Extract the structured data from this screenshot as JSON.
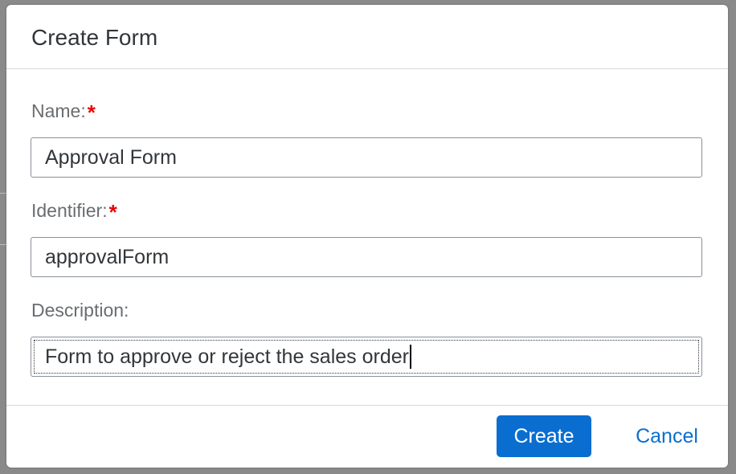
{
  "dialog": {
    "title": "Create Form"
  },
  "form": {
    "name": {
      "label": "Name:",
      "required_mark": "*",
      "value": "Approval Form"
    },
    "identifier": {
      "label": "Identifier:",
      "required_mark": "*",
      "value": "approvalForm"
    },
    "description": {
      "label": "Description:",
      "value": "Form to approve or reject the sales order"
    }
  },
  "footer": {
    "create_label": "Create",
    "cancel_label": "Cancel"
  },
  "colors": {
    "accent": "#0a6ed1",
    "required": "#e00000",
    "label": "#6a6d70",
    "text": "#32363a"
  }
}
